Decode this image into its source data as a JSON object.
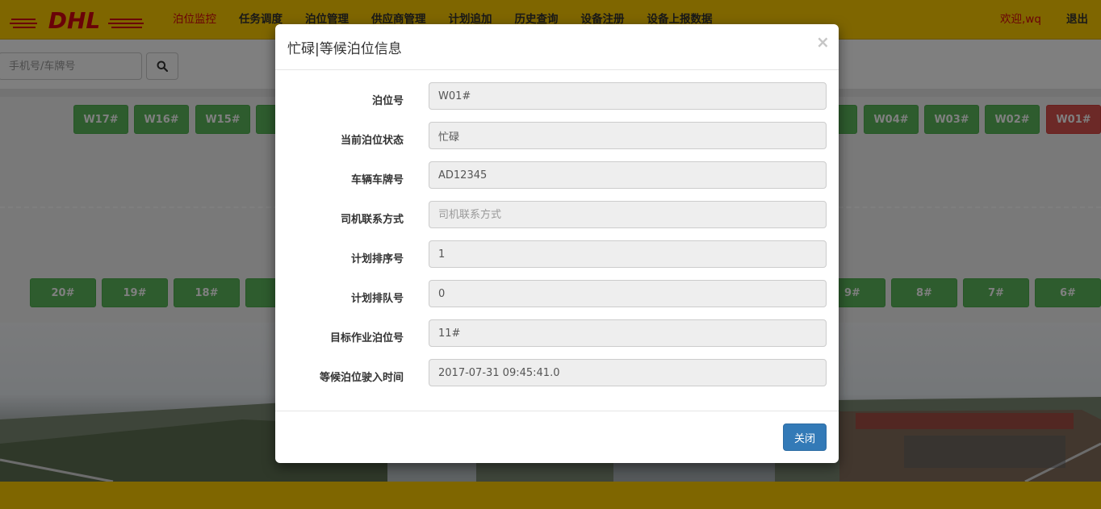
{
  "nav": {
    "brand": "DHL",
    "items": [
      {
        "label": "泊位监控",
        "active": true
      },
      {
        "label": "任务调度"
      },
      {
        "label": "泊位管理"
      },
      {
        "label": "供应商管理"
      },
      {
        "label": "计划追加"
      },
      {
        "label": "历史查询"
      },
      {
        "label": "设备注册"
      },
      {
        "label": "设备上报数据"
      }
    ],
    "welcome": "欢迎,wq",
    "logout": "退出"
  },
  "search": {
    "placeholder": "手机号/车牌号",
    "icon": "search-icon"
  },
  "yard": {
    "top_row": [
      {
        "label": "W17#",
        "status": "free"
      },
      {
        "label": "W16#",
        "status": "free"
      },
      {
        "label": "W15#",
        "status": "free"
      },
      {
        "label": "W",
        "status": "free"
      },
      {
        "label": "#",
        "status": "free"
      },
      {
        "label": "W04#",
        "status": "free"
      },
      {
        "label": "W03#",
        "status": "free"
      },
      {
        "label": "W02#",
        "status": "free"
      },
      {
        "label": "W01#",
        "status": "busy"
      }
    ],
    "bottom_row": [
      {
        "label": "20#",
        "status": "free"
      },
      {
        "label": "19#",
        "status": "free"
      },
      {
        "label": "18#",
        "status": "free"
      },
      {
        "label": "1",
        "status": "free"
      },
      {
        "label": "9#",
        "status": "free"
      },
      {
        "label": "8#",
        "status": "free"
      },
      {
        "label": "7#",
        "status": "free"
      },
      {
        "label": "6#",
        "status": "free"
      }
    ]
  },
  "modal": {
    "title": "忙碌|等候泊位信息",
    "close_symbol": "×",
    "fields": [
      {
        "label": "泊位号",
        "value": "W01#",
        "placeholder": ""
      },
      {
        "label": "当前泊位状态",
        "value": "忙碌",
        "placeholder": ""
      },
      {
        "label": "车辆车牌号",
        "value": "AD12345",
        "placeholder": ""
      },
      {
        "label": "司机联系方式",
        "value": "",
        "placeholder": "司机联系方式"
      },
      {
        "label": "计划排序号",
        "value": "1",
        "placeholder": ""
      },
      {
        "label": "计划排队号",
        "value": "0",
        "placeholder": ""
      },
      {
        "label": "目标作业泊位号",
        "value": "11#",
        "placeholder": ""
      },
      {
        "label": "等候泊位驶入时间",
        "value": "2017-07-31 09:45:41.0",
        "placeholder": ""
      }
    ],
    "close_button": "关闭"
  },
  "colors": {
    "brand_yellow": "#ffcc00",
    "brand_red": "#d40511",
    "berth_free": "#5cb85c",
    "berth_busy": "#d9534f",
    "primary": "#337ab7"
  }
}
